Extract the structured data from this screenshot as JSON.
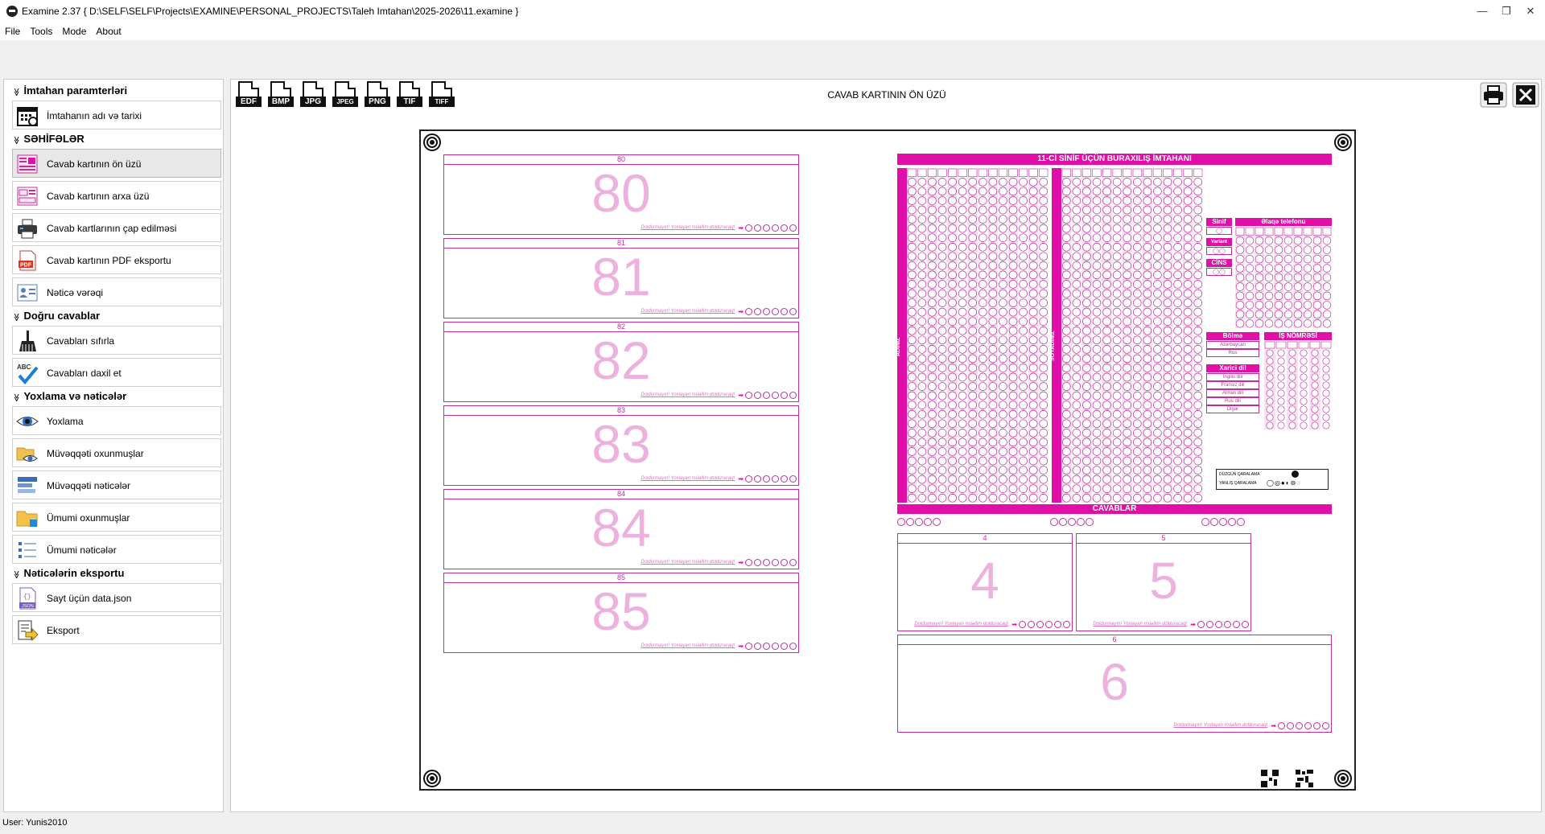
{
  "window": {
    "title": "Examine 2.37 { D:\\SELF\\SELF\\Projects\\EXAMINE\\PERSONAL_PROJECTS\\Taleh Imtahan\\2025-2026\\11.examine }",
    "minimize": "—",
    "restore": "❐",
    "close": "✕"
  },
  "menu": [
    "File",
    "Tools",
    "Mode",
    "About"
  ],
  "sidebar": {
    "sections": [
      {
        "title": "İmtahan paramterləri",
        "items": [
          {
            "label": "İmtahanın adı və tarixi",
            "icon": "calendar-icon"
          }
        ]
      },
      {
        "title": "SƏHİFƏLƏR",
        "items": [
          {
            "label": "Cavab kartının ön üzü",
            "icon": "card-front-icon",
            "active": true
          },
          {
            "label": "Cavab kartının arxa üzü",
            "icon": "card-back-icon"
          },
          {
            "label": "Cavab kartlarının çap edilməsi",
            "icon": "printer-icon"
          },
          {
            "label": "Cavab kartının PDF eksportu",
            "icon": "pdf-icon"
          },
          {
            "label": "Nəticə vərəqi",
            "icon": "result-sheet-icon"
          }
        ]
      },
      {
        "title": "Doğru cavablar",
        "items": [
          {
            "label": "Cavabları sıfırla",
            "icon": "broom-icon"
          },
          {
            "label": "Cavabları daxil et",
            "icon": "abc-check-icon"
          }
        ]
      },
      {
        "title": "Yoxlama və nəticələr",
        "items": [
          {
            "label": "Yoxlama",
            "icon": "eye-icon"
          },
          {
            "label": "Müvəqqəti oxunmuşlar",
            "icon": "folder-eye-icon"
          },
          {
            "label": "Müvəqqəti nəticələr",
            "icon": "list-icon"
          },
          {
            "label": "Ümumi oxunmuşlar",
            "icon": "folder-icon"
          },
          {
            "label": "Ümumi nəticələr",
            "icon": "list-bullets-icon"
          }
        ]
      },
      {
        "title": "Nəticələrin eksportu",
        "items": [
          {
            "label": "Sayt üçün data.json",
            "icon": "json-file-icon"
          },
          {
            "label": "Eksport",
            "icon": "export-icon"
          }
        ]
      }
    ]
  },
  "toolbar": {
    "formats": [
      "EDF",
      "BMP",
      "JPG",
      "JPEG",
      "PNG",
      "TIF",
      "TIFF"
    ],
    "page_title": "CAVAB KARTININ ÖN ÜZÜ",
    "print_icon": "printer-icon",
    "close_icon": "close-icon"
  },
  "sheet": {
    "left_boxes": [
      "80",
      "81",
      "82",
      "83",
      "84",
      "85"
    ],
    "header_band": "11-Cİ SİNİF ÜÇÜN BURAXILIŞ İMTAHANI",
    "vert_label_1": "ADINIZ",
    "vert_label_2": "SOYADINIZ",
    "sinif_label": "Sinif",
    "variant_label": "Variant",
    "cins_label": "CİNS",
    "phone_label": "Əlaqə telefonu",
    "bolme_label": "Bölmə",
    "bolme_opts": [
      "Azərbaycan",
      "Rus"
    ],
    "xarici_label": "Xarici dil",
    "xarici_opts": [
      "İngilis dili",
      "Fransız dili",
      "Alman dili",
      "Rus dili",
      "Digər"
    ],
    "is_label": "İŞ NÖMRƏSİ",
    "legend_right": "DÜZGÜN QARALAMA",
    "legend_wrong": "YANLIŞ QARALAMA",
    "answers_band": "CAVABLAR",
    "right_boxes": [
      "4",
      "5",
      "6"
    ],
    "note": "Doldurmayın! Yoxlayan müəllim dolduracaq!"
  },
  "status": {
    "user": "User: Yunis2010"
  },
  "colors": {
    "accent": "#e10ea8",
    "faint": "#ecb2dd",
    "line": "#c02e9c"
  }
}
